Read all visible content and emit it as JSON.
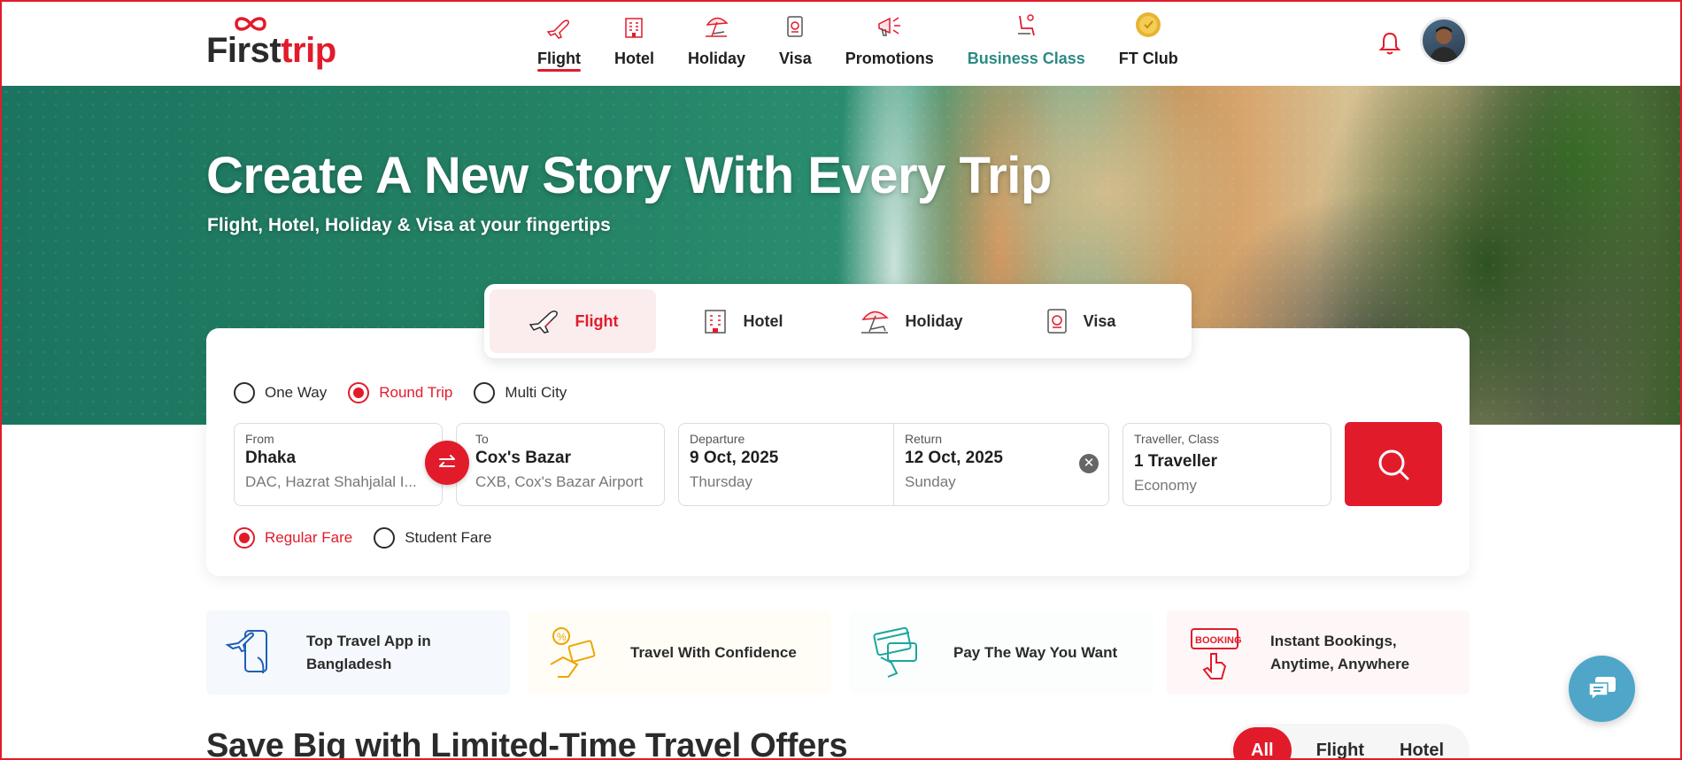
{
  "brand": {
    "logo_part1": "First",
    "logo_part2": "trip"
  },
  "nav": {
    "items": [
      {
        "label": "Flight",
        "icon": "plane-icon",
        "active": true
      },
      {
        "label": "Hotel",
        "icon": "building-icon"
      },
      {
        "label": "Holiday",
        "icon": "beach-umbrella-icon"
      },
      {
        "label": "Visa",
        "icon": "passport-icon"
      },
      {
        "label": "Promotions",
        "icon": "megaphone-icon"
      },
      {
        "label": "Business Class",
        "icon": "seat-icon"
      },
      {
        "label": "FT Club",
        "icon": "coin-icon"
      }
    ]
  },
  "hero": {
    "title": "Create A New Story With Every Trip",
    "subtitle": "Flight, Hotel, Holiday & Visa at your fingertips"
  },
  "search": {
    "tabs": [
      {
        "label": "Flight",
        "icon": "plane-icon",
        "active": true
      },
      {
        "label": "Hotel",
        "icon": "building-icon"
      },
      {
        "label": "Holiday",
        "icon": "beach-umbrella-icon"
      },
      {
        "label": "Visa",
        "icon": "passport-icon"
      }
    ],
    "trip_types": [
      "One Way",
      "Round Trip",
      "Multi City"
    ],
    "trip_type_selected": "Round Trip",
    "from": {
      "label": "From",
      "city": "Dhaka",
      "airport": "DAC, Hazrat Shahjalal I..."
    },
    "to": {
      "label": "To",
      "city": "Cox's Bazar",
      "airport": "CXB, Cox's Bazar Airport"
    },
    "departure": {
      "label": "Departure",
      "date": "9 Oct, 2025",
      "day": "Thursday"
    },
    "return": {
      "label": "Return",
      "date": "12 Oct, 2025",
      "day": "Sunday"
    },
    "traveller": {
      "label": "Traveller, Class",
      "count": "1 Traveller",
      "class": "Economy"
    },
    "fare_types": [
      "Regular Fare",
      "Student Fare"
    ],
    "fare_selected": "Regular Fare"
  },
  "features": [
    {
      "text": "Top Travel App in Bangladesh",
      "icon": "phone-plane-icon",
      "color": "#1f5fb8"
    },
    {
      "text": "Travel With Confidence",
      "icon": "hand-percent-icon",
      "color": "#f0a500"
    },
    {
      "text": "Pay The Way You Want",
      "icon": "card-payment-icon",
      "color": "#1aa6a0"
    },
    {
      "text": "Instant Bookings, Anytime, Anywhere",
      "icon": "booking-tap-icon",
      "color": "#e21b2b",
      "badge": "BOOKING"
    }
  ],
  "offers": {
    "title": "Save Big with Limited-Time Travel Offers",
    "filters": [
      "All",
      "Flight",
      "Hotel"
    ],
    "filter_selected": "All"
  },
  "colors": {
    "accent": "#e21b2b",
    "business": "#2b8a85",
    "chat": "#4fa6c8"
  }
}
